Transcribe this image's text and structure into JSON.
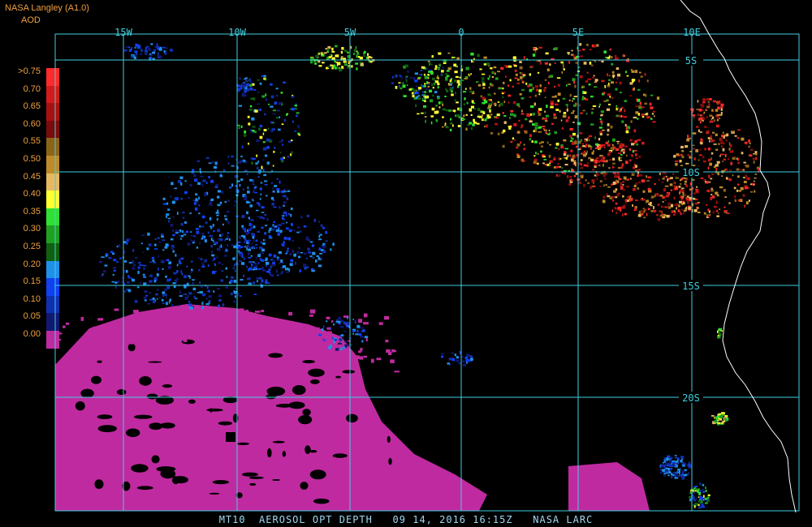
{
  "header": {
    "source": "NASA Langley (A1.0)",
    "product": "AOD"
  },
  "colorbar": {
    "labels": [
      ">0.75",
      "0.70",
      "0.65",
      "0.60",
      "0.55",
      "0.50",
      "0.45",
      "0.40",
      "0.35",
      "0.30",
      "0.25",
      "0.20",
      "0.15",
      "0.10",
      "0.05",
      "0.00"
    ],
    "colors": [
      "#ff2a2a",
      "#d41a1a",
      "#a81010",
      "#7a0c0c",
      "#8c6418",
      "#c08a28",
      "#e8b860",
      "#ffff30",
      "#30e030",
      "#20a020",
      "#106010",
      "#2090e8",
      "#1040f0",
      "#1030b0",
      "#101870",
      "#c02aa0"
    ]
  },
  "map": {
    "lon_labels": [
      "15W",
      "10W",
      "5W",
      "0",
      "5E",
      "10E"
    ],
    "lat_labels": [
      "5S",
      "10S",
      "15S",
      "20S"
    ],
    "grid_color": "#40d0e0",
    "coast_color": "#ffffff"
  },
  "footer": {
    "text": "MT10  AEROSOL OPT DEPTH   09 14, 2016 16:15Z   NASA LARC"
  }
}
